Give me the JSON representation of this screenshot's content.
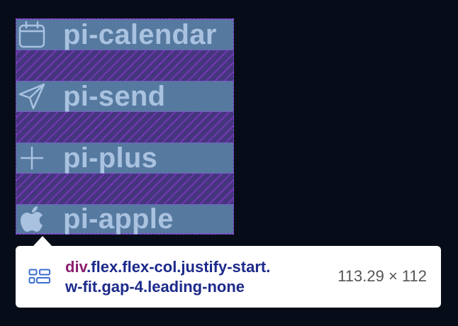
{
  "items": [
    {
      "icon": "calendar-icon",
      "label": "pi-calendar"
    },
    {
      "icon": "send-icon",
      "label": "pi-send"
    },
    {
      "icon": "plus-icon",
      "label": "pi-plus"
    },
    {
      "icon": "apple-icon",
      "label": "pi-apple"
    }
  ],
  "tooltip": {
    "icon": "flex-layout-icon",
    "tag": "div",
    "selector_line1": ".flex.flex-col.justify-start.",
    "selector_line2": "w-fit.gap-4.leading-none",
    "size": "113.29 × 112"
  },
  "colors": {
    "background": "#070d18",
    "row_fill": "#56799f",
    "label_text": "#a9c2e0",
    "gap_hatch": "#7856d2",
    "tag_color": "#8b1f6e",
    "selector_color": "#1c2a8a"
  }
}
